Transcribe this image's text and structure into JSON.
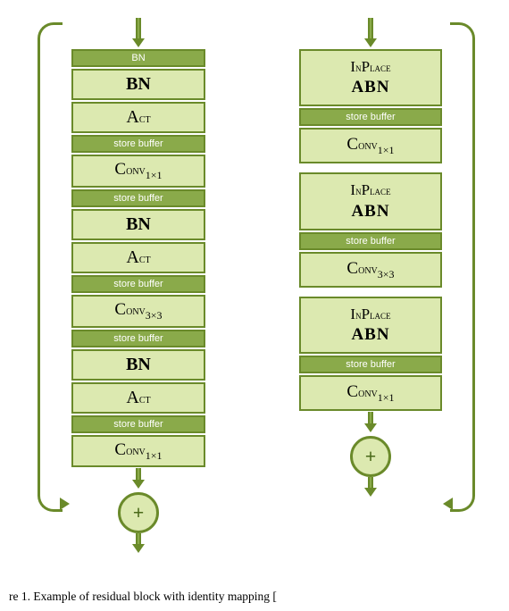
{
  "left_column": {
    "blocks": [
      {
        "type": "plain",
        "label": "BN"
      },
      {
        "type": "store",
        "label": "store buffer"
      },
      {
        "type": "plain",
        "label": "ACT"
      },
      {
        "type": "store",
        "label": "store buffer"
      },
      {
        "type": "conv",
        "label": "Conv",
        "sub": "1×1"
      },
      {
        "type": "store",
        "label": "store buffer"
      },
      {
        "type": "plain",
        "label": "BN"
      },
      {
        "type": "plain",
        "label": "ACT"
      },
      {
        "type": "store",
        "label": "store buffer"
      },
      {
        "type": "conv",
        "label": "Conv",
        "sub": "3×3"
      },
      {
        "type": "store",
        "label": "store buffer"
      },
      {
        "type": "plain",
        "label": "BN"
      },
      {
        "type": "plain",
        "label": "ACT"
      },
      {
        "type": "store",
        "label": "store buffer"
      },
      {
        "type": "conv",
        "label": "Conv",
        "sub": "1×1"
      }
    ]
  },
  "right_column": {
    "blocks": [
      {
        "type": "double",
        "label": "InPlace ABN"
      },
      {
        "type": "store",
        "label": "store buffer"
      },
      {
        "type": "conv",
        "label": "Conv",
        "sub": "1×1"
      },
      {
        "type": "double",
        "label": "InPlace ABN"
      },
      {
        "type": "store",
        "label": "store buffer"
      },
      {
        "type": "conv",
        "label": "Conv",
        "sub": "3×3"
      },
      {
        "type": "double",
        "label": "InPlace ABN"
      },
      {
        "type": "store",
        "label": "store buffer"
      },
      {
        "type": "conv",
        "label": "Conv",
        "sub": "1×1"
      }
    ]
  },
  "caption": "re 1. Example of residual block with identity mapping [",
  "plus_symbol": "+",
  "store_label": "store buffer",
  "inplace_label": "InPlace",
  "abn_label": "ABN",
  "conv_label": "Conv"
}
